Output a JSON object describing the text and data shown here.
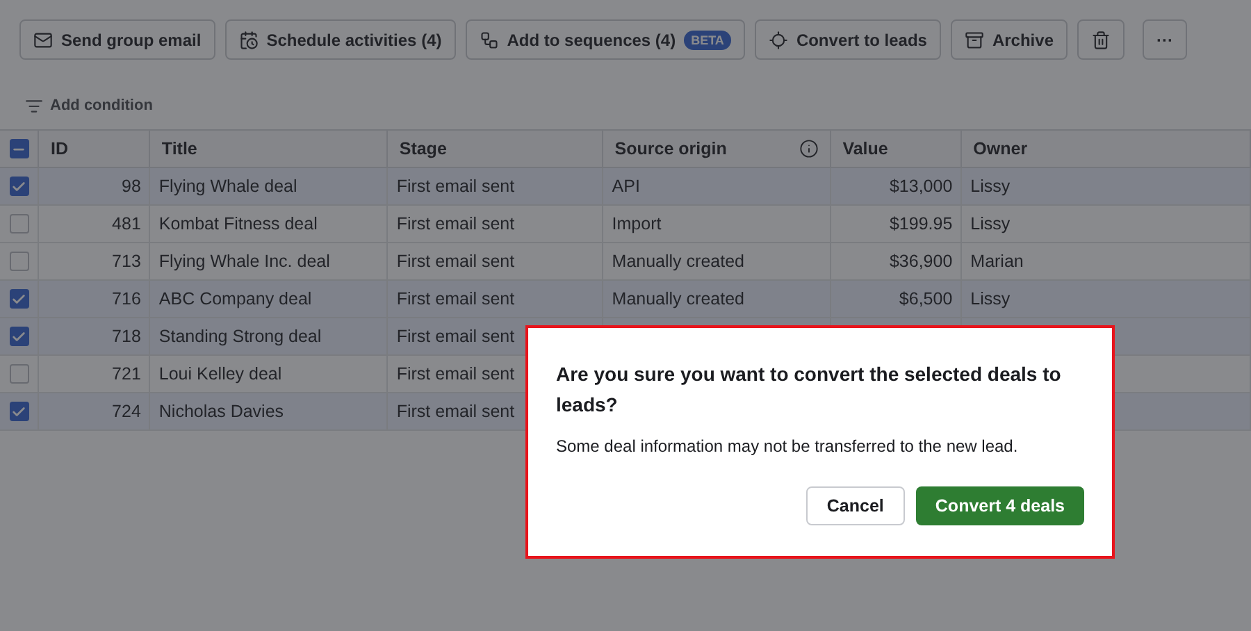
{
  "toolbar": {
    "buttons": [
      {
        "kind": "mail",
        "label": "Send group email"
      },
      {
        "kind": "calendar",
        "label": "Schedule activities (4)"
      },
      {
        "kind": "sequence",
        "label": "Add to sequences (4)",
        "badge": "BETA"
      },
      {
        "kind": "target",
        "label": "Convert to leads"
      },
      {
        "kind": "archive",
        "label": "Archive"
      },
      {
        "kind": "trash"
      },
      {
        "kind": "more",
        "label": "···"
      }
    ]
  },
  "filter": {
    "label": "Add condition"
  },
  "table": {
    "header_checkbox": {
      "indeterminate": true
    },
    "columns": [
      "ID",
      "Title",
      "Stage",
      "Source origin",
      "Value",
      "Owner"
    ],
    "rows": [
      {
        "selected": true,
        "id": "98",
        "title": "Flying Whale deal",
        "stage": "First email sent",
        "source": "API",
        "value": "$13,000",
        "owner": "Lissy"
      },
      {
        "selected": false,
        "id": "481",
        "title": "Kombat Fitness deal",
        "stage": "First email sent",
        "source": "Import",
        "value": "$199.95",
        "owner": "Lissy"
      },
      {
        "selected": false,
        "id": "713",
        "title": "Flying Whale Inc. deal",
        "stage": "First email sent",
        "source": "Manually created",
        "value": "$36,900",
        "owner": "Marian"
      },
      {
        "selected": true,
        "id": "716",
        "title": "ABC Company deal",
        "stage": "First email sent",
        "source": "Manually created",
        "value": "$6,500",
        "owner": "Lissy"
      },
      {
        "selected": true,
        "id": "718",
        "title": "Standing Strong deal",
        "stage": "First email sent"
      },
      {
        "selected": false,
        "id": "721",
        "title": "Loui Kelley deal",
        "stage": "First email sent"
      },
      {
        "selected": true,
        "id": "724",
        "title": "Nicholas Davies",
        "stage": "First email sent"
      }
    ]
  },
  "dialog": {
    "title": "Are you sure you want to convert the selected deals to leads?",
    "message": "Some deal information may not be transferred to the new lead.",
    "cancel": "Cancel",
    "confirm": "Convert 4 deals"
  }
}
